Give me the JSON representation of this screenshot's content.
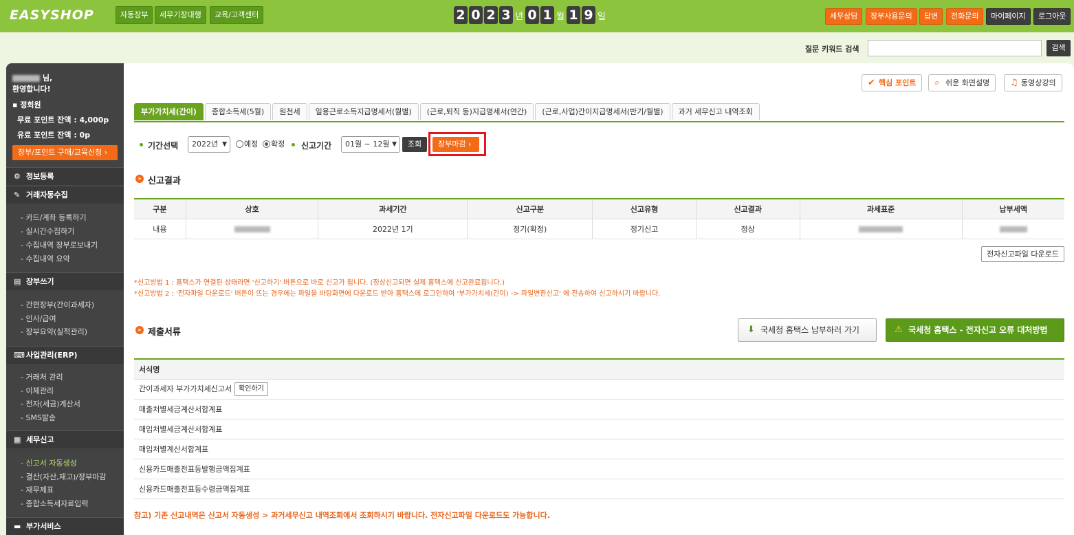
{
  "header": {
    "logo": "EASYSHOP",
    "nav": [
      "자동장부",
      "세무기장대행",
      "교육/고객센터"
    ],
    "date": {
      "year": [
        "2",
        "0",
        "2",
        "3"
      ],
      "month": [
        "0",
        "1"
      ],
      "day": [
        "1",
        "9"
      ],
      "year_unit": "년",
      "month_unit": "월",
      "day_unit": "일"
    },
    "right_buttons": [
      {
        "label": "세무상담",
        "style": "orange"
      },
      {
        "label": "장부사용문의",
        "style": "orange"
      },
      {
        "label": "답변",
        "style": "orange"
      },
      {
        "label": "전화문의",
        "style": "orange"
      },
      {
        "label": "마이페이지",
        "style": "dark"
      },
      {
        "label": "로그아웃",
        "style": "dark"
      }
    ]
  },
  "search": {
    "label": "질문 키워드 검색",
    "value": "",
    "button": "검색"
  },
  "sidebar": {
    "greeting_suffix": "님,",
    "welcome": "환영합니다!",
    "member_type": "▪ 정회원",
    "free_points": "무료 포인트 잔액 : 4,000p",
    "paid_points": "유료 포인트 잔액 : 0p",
    "buy_button": "장부/포인트 구매/교육신청  ›",
    "sections": [
      {
        "title": "정보등록",
        "icon": "gear-icon",
        "items": []
      },
      {
        "title": "거래자동수집",
        "icon": "edit-icon",
        "items": [
          "- 카드/계좌 등록하기",
          "- 실시간수집하기",
          "- 수집내역 장부로보내기",
          "- 수집내역 요약"
        ]
      },
      {
        "title": "장부쓰기",
        "icon": "book-icon",
        "items": [
          "- 간편장부(간이과세자)",
          "- 인사/급여",
          "- 장부요약(실적관리)"
        ]
      },
      {
        "title": "사업관리(ERP)",
        "icon": "keyboard-icon",
        "items": [
          "- 거래처 관리",
          "- 이체관리",
          "- 전자(세금)계산서",
          "- SMS발송"
        ]
      },
      {
        "title": "세무신고",
        "icon": "calculator-icon",
        "items": [
          "- 신고서 자동생성",
          "- 결산(자산,재고)/장부마감",
          "- 재무제표",
          "- 종합소득세자료입력"
        ],
        "active_index": 0
      },
      {
        "title": "부가서비스",
        "icon": "folder-icon",
        "items": []
      }
    ]
  },
  "main": {
    "help_buttons": [
      "핵심 포인트",
      "쉬운 화면설명",
      "동영상강의"
    ],
    "tabs": [
      "부가가치세(간이)",
      "종합소득세(5월)",
      "원천세",
      "일용근로소득지급명세서(월별)",
      "(근로,퇴직 등)지급명세서(연간)",
      "(근로,사업)간이지급명세서(반기/월별)",
      "과거 세무신고 내역조회"
    ],
    "active_tab": 0,
    "filter": {
      "period_label": "기간선택",
      "year": "2022년",
      "radio_expected": "예정",
      "radio_confirmed": "확정",
      "radio_selected": "확정",
      "report_period_label": "신고기간",
      "months": "01월 ~ 12월",
      "query_button": "조회",
      "close_button": "장부마감  ›"
    },
    "result": {
      "title": "신고결과",
      "headers": [
        "구분",
        "상호",
        "과세기간",
        "신고구분",
        "신고유형",
        "신고결과",
        "과세표준",
        "납부세액"
      ],
      "row": [
        "내용",
        "",
        "2022년 1기",
        "정기(확정)",
        "정기신고",
        "정상",
        "",
        ""
      ],
      "efile_button": "전자신고파일 다운로드"
    },
    "notes": [
      "*신고방법 1 : 홈택스가 연결된 상태라면 '신고하기' 버튼으로 바로 신고가 됩니다. (정상신고되면 실제 홈택스에 신고완료됩니다.)",
      "*신고방법 2 : '전자파일 다운로드' 버튼이 뜨는 경우에는 파일을 바탕화면에 다운로드 받아 홈택스에 로그인하여 '부가가치세(간이) -> 파일변환신고' 에 전송하여 신고하시기 바랍니다."
    ],
    "docs": {
      "title": "제출서류",
      "hometax_button": "국세청 홈택스 납부하러 가기",
      "error_button": "국세청 홈택스 - 전자신고 오류 대처방법",
      "header": "서식명",
      "rows": [
        "간이과세자 부가가치세신고서",
        "매출처별세금계산서합계표",
        "매입처별세금계산서합계표",
        "매입처별계산서합계표",
        "신용카드매출전표등발행금액집계표",
        "신용카드매출전표등수령금액집계표"
      ],
      "confirm_button": "확인하기"
    },
    "reference": "참고) 기존 신고내역은 신고서 자동생성 > 과거세무신고 내역조회에서 조회하시기 바랍니다. 전자신고파일 다운로드도 가능합니다."
  },
  "colors": {
    "brand_green": "#8cc43d",
    "tab_green": "#6aa31f",
    "orange": "#f36a17",
    "highlight_red": "#e8141b",
    "sidebar": "#434343"
  }
}
